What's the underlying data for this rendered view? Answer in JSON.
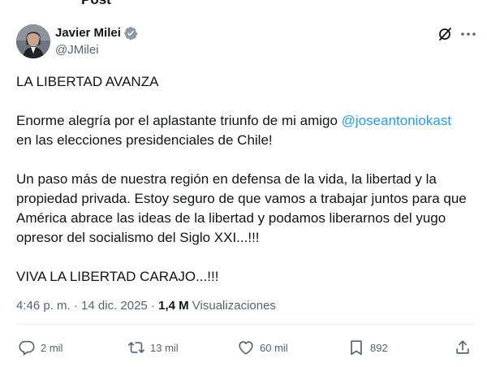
{
  "top_strip": {
    "text": "Post"
  },
  "author": {
    "display_name": "Javier Milei",
    "handle": "@JMilei",
    "verified": true,
    "verified_color": "#1d9bf0"
  },
  "header_icons": [
    "grok-slash-icon",
    "more-icon"
  ],
  "post": {
    "line1": "LA LIBERTAD AVANZA",
    "p2_before": "Enorme alegría por el aplastante triunfo de mi amigo ",
    "p2_mention": "@joseantoniokast",
    "p2_after": "\nen las elecciones presidenciales de Chile!",
    "p3": "Un paso más de nuestra región en defensa de la vida, la libertad y la propiedad privada. Estoy seguro de que vamos a trabajar juntos para que América abrace las ideas de la libertad y podamos liberarnos del yugo opresor del socialismo del Siglo XXI...!!!",
    "p4": "VIVA LA LIBERTAD CARAJO...!!!"
  },
  "meta": {
    "time": "4:46 p. m.",
    "separator": " · ",
    "date": "14 dic. 2025",
    "views_count": "1,4 M",
    "views_label": " Visualizaciones"
  },
  "actions": {
    "replies": "2 mil",
    "reposts": "13 mil",
    "likes": "60 mil",
    "bookmarks": "892"
  },
  "colors": {
    "text": "#0f1419",
    "secondary": "#536471",
    "link": "#1d9bf0",
    "divider": "#eff3f4"
  }
}
